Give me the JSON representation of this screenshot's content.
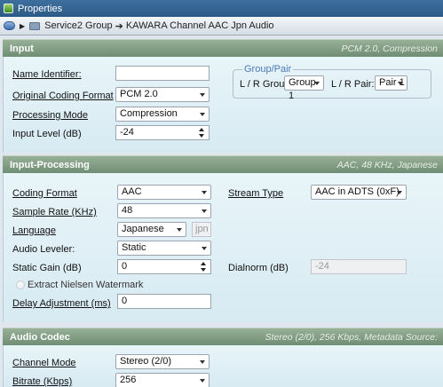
{
  "window": {
    "title": "Properties"
  },
  "breadcrumb": {
    "group": "Service2 Group",
    "separator": "➔",
    "item": "KAWARA Channel AAC Jpn Audio"
  },
  "input": {
    "header": "Input",
    "summary": "PCM 2.0, Compression",
    "name_identifier": {
      "label": "Name Identifier:",
      "value": ""
    },
    "original_coding_format": {
      "label": "Original Coding Format",
      "value": "PCM 2.0"
    },
    "processing_mode": {
      "label": "Processing Mode",
      "value": "Compression"
    },
    "input_level": {
      "label": "Input Level (dB)",
      "value": "-24"
    },
    "group_pair": {
      "legend": "Group/Pair",
      "lr_group_label": "L / R Group:",
      "lr_group_value": "Group 1",
      "lr_pair_label": "L / R Pair:",
      "lr_pair_value": "Pair 1"
    }
  },
  "input_processing": {
    "header": "Input-Processing",
    "summary": "AAC, 48 KHz, Japanese",
    "coding_format": {
      "label": "Coding Format",
      "value": "AAC"
    },
    "stream_type": {
      "label": "Stream Type",
      "value": "AAC in ADTS (0xF)"
    },
    "sample_rate": {
      "label": "Sample Rate (KHz)",
      "value": "48"
    },
    "language": {
      "label": "Language",
      "value": "Japanese",
      "code": "jpn"
    },
    "audio_leveler": {
      "label": "Audio Leveler:",
      "value": "Static"
    },
    "static_gain": {
      "label": "Static Gain (dB)",
      "value": "0"
    },
    "dialnorm": {
      "label": "Dialnorm (dB)",
      "value": "-24"
    },
    "nielsen": {
      "label": "Extract Nielsen Watermark",
      "checked": false
    },
    "delay_adjustment": {
      "label": "Delay Adjustment (ms)",
      "value": "0"
    }
  },
  "audio_codec": {
    "header": "Audio Codec",
    "summary": "Stereo (2/0), 256 Kbps, Metadata Source:",
    "channel_mode": {
      "label": "Channel Mode",
      "value": "Stereo (2/0)"
    },
    "bitrate": {
      "label": "Bitrate (Kbps)",
      "value": "256"
    }
  }
}
